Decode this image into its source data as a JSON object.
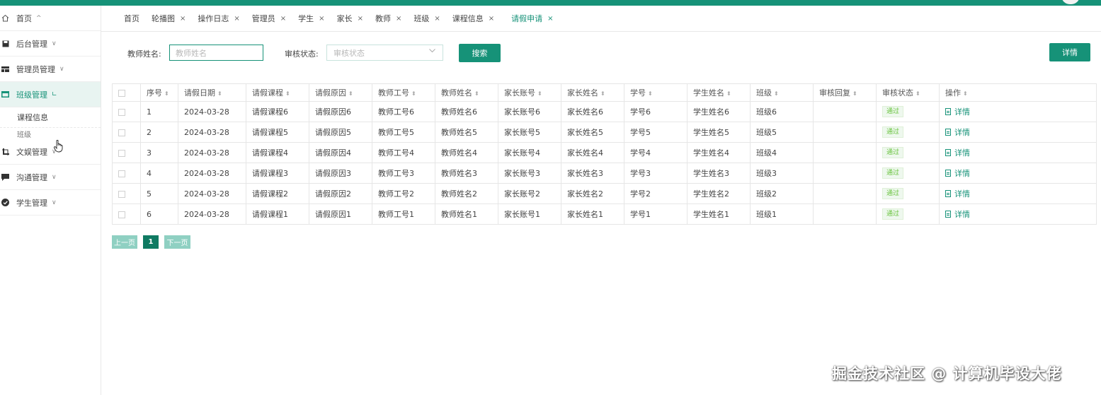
{
  "sidebar": {
    "items": [
      {
        "label": "首页",
        "icon": "home-icon",
        "arrow": "^"
      },
      {
        "label": "后台管理",
        "icon": "bookmark-icon",
        "arrow": "∨"
      },
      {
        "label": "管理员管理",
        "icon": "table-icon",
        "arrow": "∨"
      },
      {
        "label": "班级管理",
        "icon": "card-icon",
        "arrow": "∟"
      },
      {
        "label": "文娱管理",
        "icon": "crop-icon",
        "arrow": "∨"
      },
      {
        "label": "沟通管理",
        "icon": "chat-icon",
        "arrow": "∨"
      },
      {
        "label": "学生管理",
        "icon": "check-circle-icon",
        "arrow": "∨"
      }
    ],
    "submenu": [
      "课程信息",
      "班级"
    ]
  },
  "tabs": [
    {
      "label": "首页",
      "closable": false
    },
    {
      "label": "轮播图",
      "closable": true
    },
    {
      "label": "操作日志",
      "closable": true
    },
    {
      "label": "管理员",
      "closable": true
    },
    {
      "label": "学生",
      "closable": true
    },
    {
      "label": "家长",
      "closable": true
    },
    {
      "label": "教师",
      "closable": true
    },
    {
      "label": "班级",
      "closable": true
    },
    {
      "label": "课程信息",
      "closable": true
    },
    {
      "label": "请假申请",
      "closable": true,
      "active": true
    }
  ],
  "close_glyph": "×",
  "search": {
    "teacher_label": "教师姓名:",
    "teacher_placeholder": "教师姓名",
    "status_label": "审核状态:",
    "status_placeholder": "审核状态",
    "search_button": "搜索",
    "detail_button": "详情"
  },
  "table": {
    "columns": [
      "序号",
      "请假日期",
      "请假课程",
      "请假原因",
      "教师工号",
      "教师姓名",
      "家长账号",
      "家长姓名",
      "学号",
      "学生姓名",
      "班级",
      "审核回复",
      "审核状态",
      "操作"
    ],
    "rows": [
      [
        "1",
        "2024-03-28",
        "请假课程6",
        "请假原因6",
        "教师工号6",
        "教师姓名6",
        "家长账号6",
        "家长姓名6",
        "学号6",
        "学生姓名6",
        "班级6",
        "",
        "通过",
        "详情"
      ],
      [
        "2",
        "2024-03-28",
        "请假课程5",
        "请假原因5",
        "教师工号5",
        "教师姓名5",
        "家长账号5",
        "家长姓名5",
        "学号5",
        "学生姓名5",
        "班级5",
        "",
        "通过",
        "详情"
      ],
      [
        "3",
        "2024-03-28",
        "请假课程4",
        "请假原因4",
        "教师工号4",
        "教师姓名4",
        "家长账号4",
        "家长姓名4",
        "学号4",
        "学生姓名4",
        "班级4",
        "",
        "通过",
        "详情"
      ],
      [
        "4",
        "2024-03-28",
        "请假课程3",
        "请假原因3",
        "教师工号3",
        "教师姓名3",
        "家长账号3",
        "家长姓名3",
        "学号3",
        "学生姓名3",
        "班级3",
        "",
        "通过",
        "详情"
      ],
      [
        "5",
        "2024-03-28",
        "请假课程2",
        "请假原因2",
        "教师工号2",
        "教师姓名2",
        "家长账号2",
        "家长姓名2",
        "学号2",
        "学生姓名2",
        "班级2",
        "",
        "通过",
        "详情"
      ],
      [
        "6",
        "2024-03-28",
        "请假课程1",
        "请假原因1",
        "教师工号1",
        "教师姓名1",
        "家长账号1",
        "家长姓名1",
        "学号1",
        "学生姓名1",
        "班级1",
        "",
        "通过",
        "详情"
      ]
    ]
  },
  "pager": {
    "prev": "上一页",
    "current": "1",
    "next": "下一页"
  },
  "watermark": "掘金技术社区 @ 计算机毕设大佬",
  "colors": {
    "primary": "#169278",
    "success": "#67c23a"
  }
}
